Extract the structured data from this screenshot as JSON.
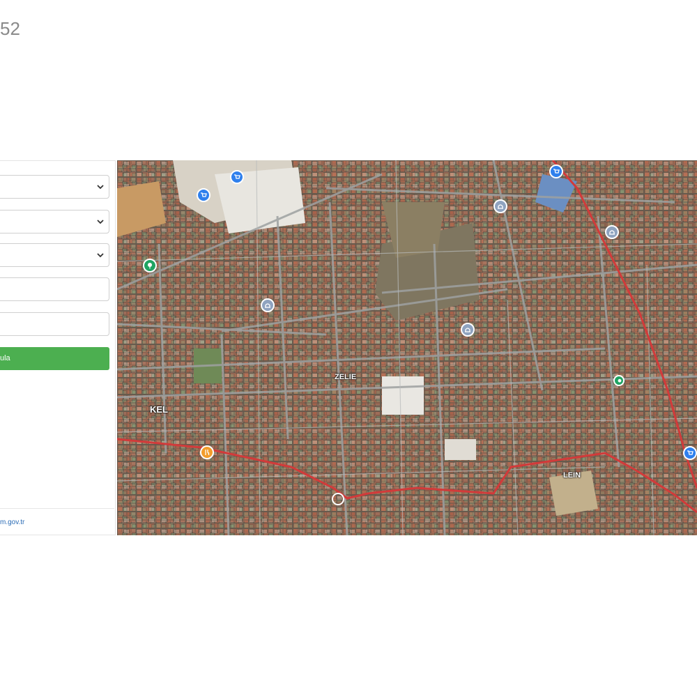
{
  "header": {
    "title": "52"
  },
  "form": {
    "search_button_label": "ula"
  },
  "footer": {
    "link_text": "m.gov.tr"
  },
  "map": {
    "labels": {
      "district_1": "KEL",
      "district_2": "ZELIE",
      "district_3": "LEIN"
    },
    "colors": {
      "road": "#d23a3a",
      "pin_blue": "#2f80ed",
      "pin_green": "#1fa463",
      "pin_orange": "#f39c2b",
      "pin_gray": "#8fa3bf"
    }
  }
}
